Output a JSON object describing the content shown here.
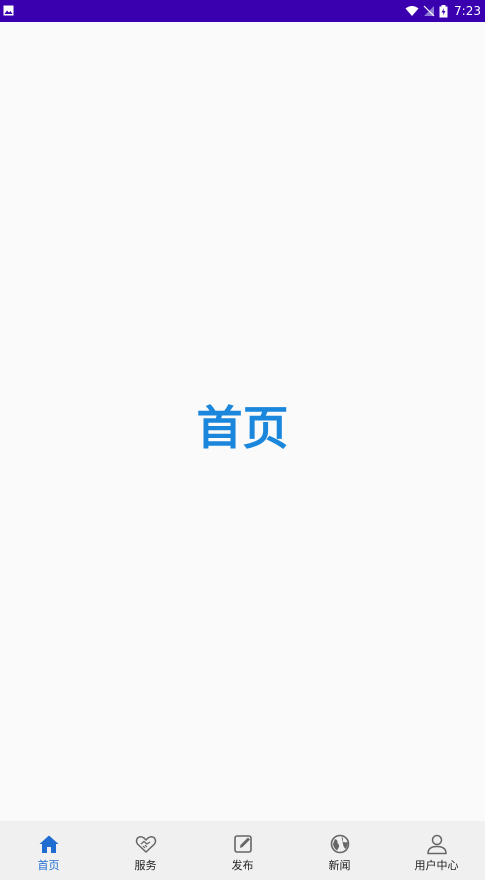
{
  "status_bar": {
    "time": "7:23"
  },
  "main": {
    "title": "首页"
  },
  "tabs": [
    {
      "label": "首页",
      "icon": "home-icon",
      "active": true
    },
    {
      "label": "服务",
      "icon": "handshake-icon",
      "active": false
    },
    {
      "label": "发布",
      "icon": "edit-icon",
      "active": false
    },
    {
      "label": "新闻",
      "icon": "globe-icon",
      "active": false
    },
    {
      "label": "用户中心",
      "icon": "user-icon",
      "active": false
    }
  ],
  "colors": {
    "status_bar": "#3a00b0",
    "accent": "#1a87dc",
    "active_tab": "#1f6dd1",
    "inactive_icon": "#666666"
  }
}
